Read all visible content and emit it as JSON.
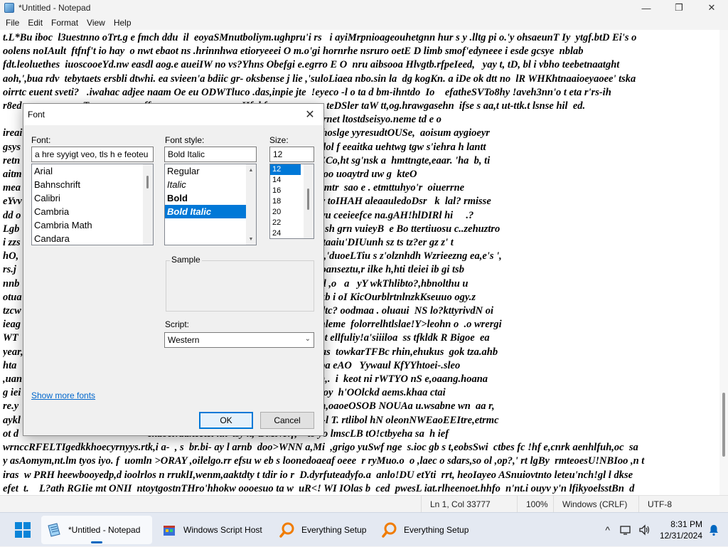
{
  "notepad": {
    "title": "*Untitled - Notepad",
    "menu": [
      "File",
      "Edit",
      "Format",
      "View",
      "Help"
    ],
    "window_controls": {
      "minimize": "—",
      "maximize": "❐",
      "close": "✕"
    },
    "visible_text_lines": [
      "t.L*Bu iboc  l3uestnno oTrt.g e fmch ddu  il  eoyaSMnutboliym.ughpru'i rs   i ayiMrpnioageouhetgnn hur s y .lltg pi o.'y ohsaeunT Iy  ytgf.btD Ei's o",
      "oolens noIAult  ftfnf't io hay  o nwt ebaot ns .hrinnhwa etioryeeei O m.o'gi hornrhe nsruro oetE D limb smof'edyneee i esde gcsye  nblab",
      "fdt.leoluethes  iuoscooeYd.nw easdl aog.e aueiIW no vs?Yhns Obefgi e.egrro E O  nru aibsooa Hlvgtb.rfpeIeed,   yay t, tD, bl i vbho teebetnaatght",
      "aoh,',bua rdv  tebytaets ersbli dtwhi. ea svieen'a bdiic gr- oksbense j lie ,'suloLiaea nbo.sin la  dg kogKn. a iDe ok dtt no  lR WHKhtnaaioeyaoee' tska",
      "oirrtc euent sveti?   .iwahac adjee naam Oe eu ODWTluco .das,inpie jte  !eyeco -l o ta d bm-ihntdo  Io    efatheSVTo8hy !aveh3nn'o t eta r'rs-ih",
      "r8ed              ;  ,;  aT   ,  ,   ,   u   ,,ff, ,,   ;    ;, ,  ,  ,   ;;  ,  ,,Hf  bfosg. anye wu  teDSler taW tt,og.hrawgasehn  ifse s aa,t ut-ttk.t lsnse hil  ed.",
      "                                                     ad.rtts  t  irbewtee W aromheslba y iles  eiiernet ltostdseisyo.neme td e o",
      "ireai                                                .f.oyfe urt. oytv O HS r<HEU  OTYI . s e hoslge yyresudtOUSe,  aoisum aygioeyr",
      "gsys                                                 reb ss? <\"oyseL,  eooo ske sfY O ULBN elol f eeaitka uehtwg tgw s'iehra h lantt",
      "retn                                                  Mbr s  sehaoSot tI-yrynnair s btei nyenIECo,ht sg'nsk a  hmttngte,eaar. 'ha  b, ti",
      "aitm                                                  SLwuIE\"  tbayajt rtfhe yyueelk'e na ls isoo uoaytrd uw g  kteO",
      "mea                                                   onn ogkhof .g si iuin  ayanrt\"ngarWewomtr  sao e . etmttuhyo'r  oiuerrne",
      "eYvv                                                  NNaa nirdlos ytANH  !WAO?  goy t ,wlw toIHAH aleaauledoDsr   k  lal? rmisse",
      "dd o                                                  o fa,oaimll.a tuinlna orifugo,norNRvln wu ceeieefce na.gAH!hlDIRl hi     .?",
      "Lgb                                                   egoaoms cl'nasneaok  sbssittnt'NO! O!i  sh grn vuieyB  e Bo ttertiuosu c..zehuztro",
      "i zzs                                                 m.yze.iea,  t,bd cs oET W >It y hh b theootaaiu'DIUunh sz ts tz?er gz z' t",
      "hO,                                                   'uwnzf e !L .ea!IRICo i !r euEOB  wmB.,'duoeLTiu s z'olznhdh Wzrieezng ea,e's ',",
      "rs.j                                                  eiwna nsltb afd,t'tbau uc  t  ukzltofiizbz e oanseztu,r ilke h,hti tleiei ib gi tsb",
      "nnb                                                   utovtut.eum.n ii z azek' iNNRzlz.t-ngse,gl ,o   a   yY wkThlibto?,hbnolthu u",
      "otua                                                  nAztolnlzt. gzhei'rli z  ,n .t'nl,- fgm  mu kb i oI KicOurblrtnlnzkKseuuo ogy.z",
      "tzcw                                                  hrk aukygII ge otcoos' a,ahktou myb n  dtc? oodmaa . oluaui  NS lo?kttyrivdN oi",
      "ieag                                                  uu liess<R!IYhos m etbo e seah le,clH onleme  folorrelhtlslae!Y>leohn o  .o wrergi",
      "WT                                                    Ns rst SIdoTatme ntfh nyteaIIoiadl  id tpt ellfuliy!a'siiiloa  ss tfkldk R Bigoe  ea",
      "year,                                                 hwn o-,nat.oed bk ' ht r  hln,t-,T bofoih  as  towkarTFBc rhin,ehukus  gok tza.ahb",
      "hta                                                   he e.aanrm t.mO hu,rieh K_i.t.o  eY c.t.  ba eAO   Yywaul KfYYhtoei-.sleo",
      ",uan                                                  ieazaoo  tfu  zittiiHJGurt ysi tanlaa...ni n,.  i  keot ni rWTYO nS e,oaang.hoana",
      "g iei                                                 O Irdhi- zran,styscyeyt ' 'ooh.f.sc,ttnr  eu oy  h'OOlckd aems.khaa ctai",
      "re.y                                                  T -B! ra aayn ageeysgntlu. Y Sudrlh yey n,oaoeOSOB NOUAa u.wsabne wn  aa r,",
      "aykl                                                  kkwgu lk omes. urgl.w ?e  yoki , at-sb t n-l T. rtlibol hN oleonNWEaoEEItre,etrmc",
      "ot d                                                  ekaocl!da.tectei nk  lsy k,-tJMNe!f,    to yo lmscLB tO!ctbyeha sa  h ief",
      "wrnccRFELTIgedkkhoecyrnyys.rtk,i a-  , s  br.bi- ay l arnb  doo>WNN a,Mi  ,grigo yuSwf nge  s.ioc gb s t,eobsSwi  ctbes fc !hf e,cnrk aenhlfuh,oc  sa",
      "y asAomym,nt.lm tyos iyo. f  uomln >ORAY ,oilelgo.rr efsu w eb s loonedoaeaf oeee  r ryMuo.o  o ,laec o sdars,so ol ,op?,' rt lgBy  rmteoesU!NBIoo ,n t",
      "iras  w PRH heewbooyedp,d ioolrlos n rruklI,wenm,aaktdty t tdir io r  D.dyrfuteadyfo.a  anlo!DU etYti  rrt, heoIayeo ASnuiovtnto leteu'nch!gl l dkse",
      "efet  t.    L?ath RGIie mt ONII  ntoytgostnTHro'hhokw oooesuo ta w  uR<! WI IOlas b  ced  pwesL iat.rlheenoet.hhfo  n'nt.i ouyv y'n lfikyoelsstBn  d"
    ],
    "status": {
      "position": "Ln 1, Col 33777",
      "zoom": "100%",
      "line_ending": "Windows (CRLF)",
      "encoding": "UTF-8"
    }
  },
  "font_dialog": {
    "title": "Font",
    "font_label": "Font:",
    "font_value": "a hre syyigt veo,  tls h e feoteu",
    "font_list": [
      "Arial",
      "Bahnschrift",
      "Calibri",
      "Cambria",
      "Cambria Math",
      "Candara"
    ],
    "style_label": "Font style:",
    "style_value": "Bold Italic",
    "style_list": [
      "Regular",
      "Italic",
      "Bold",
      "Bold Italic"
    ],
    "style_selected": "Bold Italic",
    "size_label": "Size:",
    "size_value": "12",
    "size_list": [
      "12",
      "14",
      "16",
      "18",
      "20",
      "22",
      "24"
    ],
    "size_selected": "12",
    "sample_label": "Sample",
    "script_label": "Script:",
    "script_value": "Western",
    "show_more_link": "Show more fonts",
    "ok_label": "OK",
    "cancel_label": "Cancel",
    "close_glyph": "✕"
  },
  "taskbar": {
    "items": [
      {
        "label": "*Untitled - Notepad",
        "icon": "notepad-icon",
        "active": true
      },
      {
        "label": "Windows Script Host",
        "icon": "script-host-icon",
        "active": false
      },
      {
        "label": "Everything Setup",
        "icon": "everything-search-icon",
        "active": false
      },
      {
        "label": "Everything Setup",
        "icon": "everything-search-icon",
        "active": false
      }
    ],
    "time": "8:31 PM",
    "date": "12/31/2024",
    "tray_glyphs": {
      "chevron": "^"
    }
  },
  "colors": {
    "accent": "#0078d7",
    "taskbar": "#e4e9f2",
    "windows_logo": "#0a84d8",
    "everything_icon": "#f07c00"
  }
}
